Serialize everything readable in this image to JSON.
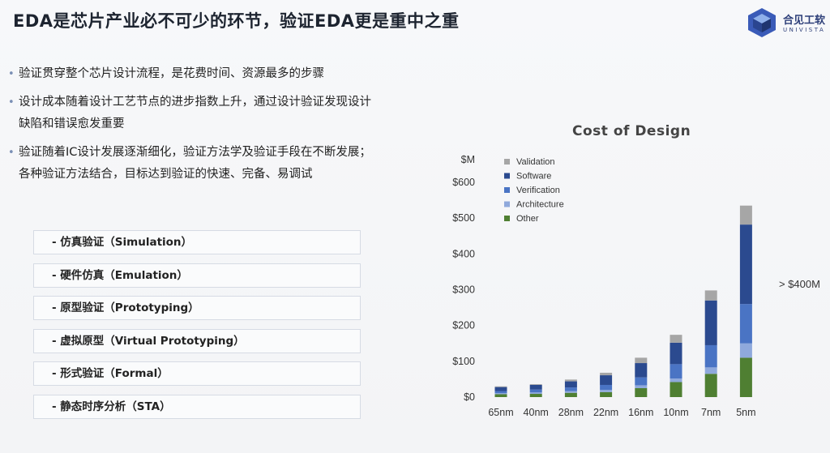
{
  "title": "EDA是芯片产业必不可少的环节，验证EDA更是重中之重",
  "logo": {
    "cn": "合见工软",
    "en": "UNIVISTA",
    "icon": "cube-logo-icon"
  },
  "bullets": [
    "验证贯穿整个芯片设计流程，是花费时间、资源最多的步骤",
    "设计成本随着设计工艺节点的进步指数上升，通过设计验证发现设计缺陷和错误愈发重要",
    "验证随着IC设计发展逐渐细化，验证方法学及验证手段在不断发展；各种验证方法结合，目标达到验证的快速、完备、易调试"
  ],
  "methods": [
    "- 仿真验证（Simulation）",
    "- 硬件仿真（Emulation）",
    "- 原型验证（Prototyping）",
    "- 虚拟原型（Virtual Prototyping）",
    "- 形式验证（Formal）",
    "- 静态时序分析（STA）"
  ],
  "colors": {
    "Validation": "#a6a6a6",
    "Software": "#2b4a8f",
    "Verification": "#4a74c4",
    "Architecture": "#8fa9dc",
    "Other": "#4f7f32"
  },
  "chart_data": {
    "type": "bar",
    "stacked": true,
    "title": "Cost of Design",
    "ylabel": "$M",
    "ylim": [
      0,
      600
    ],
    "yticks": [
      "$0",
      "$100",
      "$200",
      "$300",
      "$400",
      "$500",
      "$600"
    ],
    "categories": [
      "65nm",
      "40nm",
      "28nm",
      "22nm",
      "16nm",
      "10nm",
      "7nm",
      "5nm"
    ],
    "legend_position": "top-left",
    "series": [
      {
        "name": "Other",
        "values": [
          8,
          9,
          12,
          14,
          25,
          42,
          65,
          110
        ]
      },
      {
        "name": "Architecture",
        "values": [
          3,
          4,
          5,
          6,
          8,
          10,
          18,
          40
        ]
      },
      {
        "name": "Verification",
        "values": [
          6,
          8,
          10,
          14,
          22,
          40,
          62,
          110
        ]
      },
      {
        "name": "Software",
        "values": [
          11,
          13,
          17,
          27,
          40,
          60,
          125,
          222
        ]
      },
      {
        "name": "Validation",
        "values": [
          2,
          2,
          5,
          7,
          15,
          22,
          28,
          53
        ]
      }
    ],
    "legend_order": [
      "Validation",
      "Software",
      "Verification",
      "Architecture",
      "Other"
    ],
    "annotation": "> $400M"
  }
}
